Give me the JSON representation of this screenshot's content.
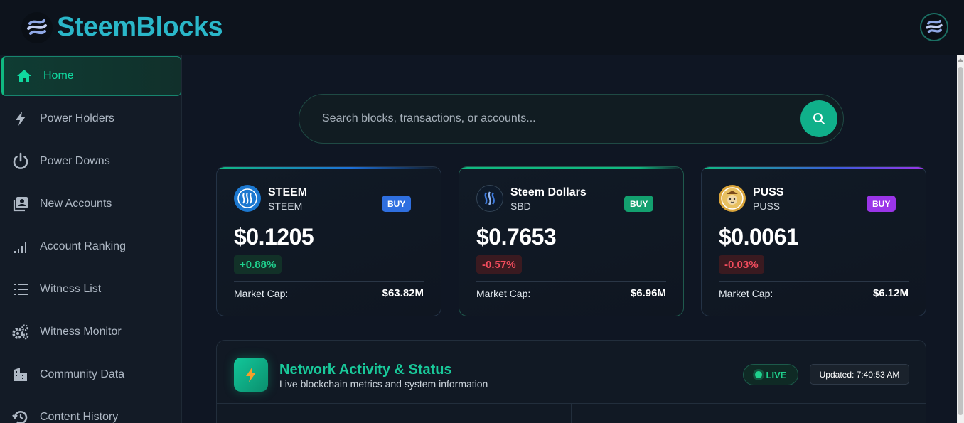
{
  "brand": {
    "name": "SteemBlocks"
  },
  "sidebar": {
    "items": [
      {
        "label": "Home",
        "icon": "home-icon",
        "active": true
      },
      {
        "label": "Power Holders",
        "icon": "lightning-icon"
      },
      {
        "label": "Power Downs",
        "icon": "power-icon"
      },
      {
        "label": "New Accounts",
        "icon": "account-box-icon"
      },
      {
        "label": "Account Ranking",
        "icon": "signal-bars-icon"
      },
      {
        "label": "Witness List",
        "icon": "list-icon"
      },
      {
        "label": "Witness Monitor",
        "icon": "gears-icon"
      },
      {
        "label": "Community Data",
        "icon": "building-icon"
      },
      {
        "label": "Content History",
        "icon": "history-icon"
      }
    ]
  },
  "search": {
    "placeholder": "Search blocks, transactions, or accounts..."
  },
  "cards": [
    {
      "name": "STEEM",
      "symbol": "STEEM",
      "buy_label": "BUY",
      "price": "$0.1205",
      "change": "+0.88%",
      "direction": "up",
      "market_cap_label": "Market Cap:",
      "market_cap": "$63.82M",
      "buy_color": "#2f6fe0"
    },
    {
      "name": "Steem Dollars",
      "symbol": "SBD",
      "buy_label": "BUY",
      "price": "$0.7653",
      "change": "-0.57%",
      "direction": "down",
      "market_cap_label": "Market Cap:",
      "market_cap": "$6.96M",
      "buy_color": "#13a06f"
    },
    {
      "name": "PUSS",
      "symbol": "PUSS",
      "buy_label": "BUY",
      "price": "$0.0061",
      "change": "-0.03%",
      "direction": "down",
      "market_cap_label": "Market Cap:",
      "market_cap": "$6.12M",
      "buy_color": "#9b35e8"
    }
  ],
  "network": {
    "title": "Network Activity & Status",
    "subtitle": "Live blockchain metrics and system information",
    "live_label": "LIVE",
    "updated": "Updated: 7:40:53 AM"
  },
  "colors": {
    "accent": "#10b981",
    "brand": "#2ab7c9",
    "background": "#0f1623"
  }
}
